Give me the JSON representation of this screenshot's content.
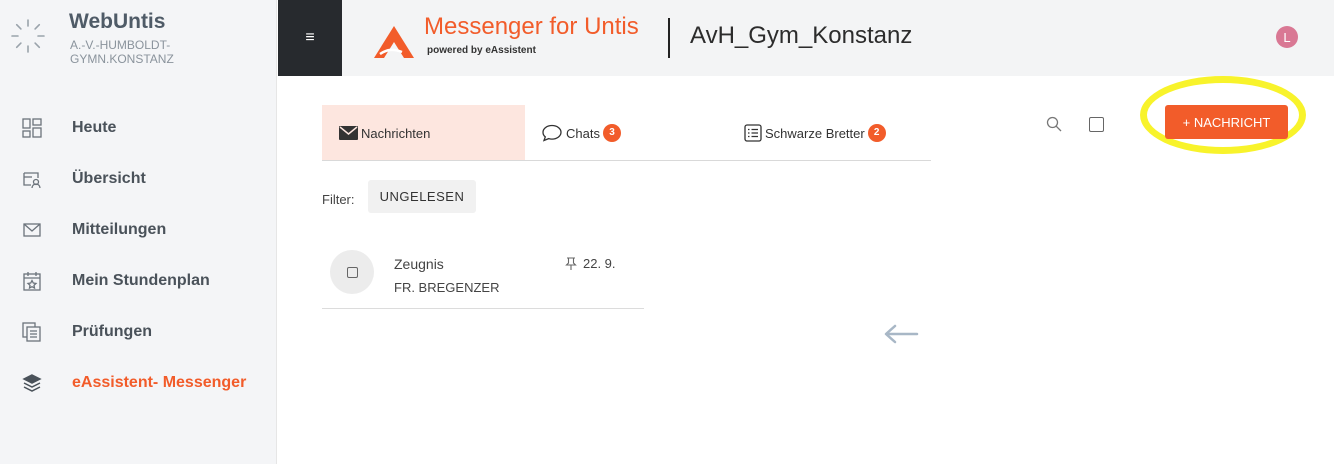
{
  "sidebar": {
    "brand_title": "WebUntis",
    "brand_sub_line1": "A.-V.-HUMBOLDT-",
    "brand_sub_line2": "GYMN.KONSTANZ",
    "items": [
      {
        "label": "Heute",
        "icon": "dashboard-icon"
      },
      {
        "label": "Übersicht",
        "icon": "overview-icon"
      },
      {
        "label": "Mitteilungen",
        "icon": "mail-icon"
      },
      {
        "label": "Mein Stundenplan",
        "icon": "calendar-star-icon"
      },
      {
        "label": "Prüfungen",
        "icon": "exams-icon"
      },
      {
        "label": "eAssistent- Messenger",
        "icon": "layers-icon",
        "active": true
      }
    ]
  },
  "header": {
    "menu_glyph": "≡",
    "app_title": "Messenger for Untis",
    "app_subtitle": "powered by eAssistent",
    "school_name": "AvH_Gym_Konstanz",
    "avatar_letter": "L"
  },
  "tabs": [
    {
      "label": "Nachrichten",
      "icon": "envelope-icon"
    },
    {
      "label": "Chats",
      "badge": "3",
      "icon": "chat-bubble-icon"
    },
    {
      "label": "Schwarze Bretter",
      "badge": "2",
      "icon": "list-board-icon"
    }
  ],
  "toolbar": {
    "new_message_label": "+ NACHRICHT"
  },
  "filter": {
    "label": "Filter:",
    "chip": "UNGELESEN"
  },
  "messages": [
    {
      "subject": "Zeugnis",
      "sender": "FR. BREGENZER",
      "date": "22. 9.",
      "pinned": true
    }
  ],
  "colors": {
    "accent": "#f25c2a",
    "highlight": "#f8f32b",
    "topbar_dark": "#272a2e"
  }
}
